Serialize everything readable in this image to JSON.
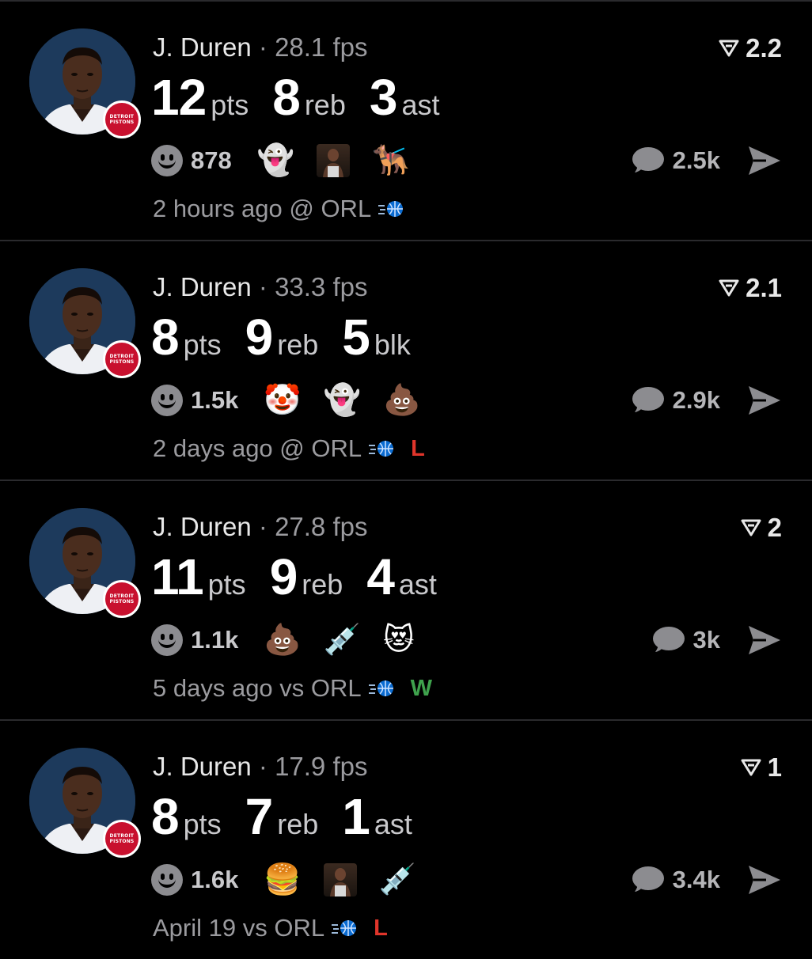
{
  "feed": {
    "cards": [
      {
        "player": "J. Duren",
        "separator": "·",
        "fps": "28.1 fps",
        "stats": [
          {
            "value": "12",
            "label": "pts"
          },
          {
            "value": "8",
            "label": "reb"
          },
          {
            "value": "3",
            "label": "ast"
          }
        ],
        "rating": "2.2",
        "reaction_count": "878",
        "reactions": [
          {
            "type": "emoji",
            "char": "👻",
            "name": "ghost-emoji"
          },
          {
            "type": "image",
            "name": "player-photo-reaction"
          },
          {
            "type": "emoji",
            "char": "🐕‍🦺",
            "name": "service-dog-emoji"
          }
        ],
        "comment_count": "2.5k",
        "time": "2 hours ago",
        "venue": "@ ORL",
        "result": ""
      },
      {
        "player": "J. Duren",
        "separator": "·",
        "fps": "33.3 fps",
        "stats": [
          {
            "value": "8",
            "label": "pts"
          },
          {
            "value": "9",
            "label": "reb"
          },
          {
            "value": "5",
            "label": "blk"
          }
        ],
        "rating": "2.1",
        "reaction_count": "1.5k",
        "reactions": [
          {
            "type": "emoji",
            "char": "🤡",
            "name": "clown-emoji"
          },
          {
            "type": "emoji",
            "char": "👻",
            "name": "ghost-emoji"
          },
          {
            "type": "emoji",
            "char": "💩",
            "name": "poop-emoji"
          }
        ],
        "comment_count": "2.9k",
        "time": "2 days ago",
        "venue": "@ ORL",
        "result": "L"
      },
      {
        "player": "J. Duren",
        "separator": "·",
        "fps": "27.8 fps",
        "stats": [
          {
            "value": "11",
            "label": "pts"
          },
          {
            "value": "9",
            "label": "reb"
          },
          {
            "value": "4",
            "label": "ast"
          }
        ],
        "rating": "2",
        "reaction_count": "1.1k",
        "reactions": [
          {
            "type": "emoji",
            "char": "💩",
            "name": "poop-emoji"
          },
          {
            "type": "emoji",
            "char": "💉",
            "name": "syringe-emoji"
          },
          {
            "type": "emoji",
            "char": "😻",
            "name": "heart-eyes-cat-emoji"
          }
        ],
        "comment_count": "3k",
        "time": "5 days ago",
        "venue": "vs ORL",
        "result": "W"
      },
      {
        "player": "J. Duren",
        "separator": "·",
        "fps": "17.9 fps",
        "stats": [
          {
            "value": "8",
            "label": "pts"
          },
          {
            "value": "7",
            "label": "reb"
          },
          {
            "value": "1",
            "label": "ast"
          }
        ],
        "rating": "1",
        "reaction_count": "1.6k",
        "reactions": [
          {
            "type": "emoji",
            "char": "🍔",
            "name": "hamburger-emoji"
          },
          {
            "type": "image",
            "name": "player-photo-reaction"
          },
          {
            "type": "emoji",
            "char": "💉",
            "name": "syringe-emoji"
          }
        ],
        "comment_count": "3.4k",
        "time": "April 19",
        "venue": "vs ORL",
        "result": "L"
      }
    ],
    "team_badge_text": "DETROIT PISTONS",
    "colors": {
      "background": "#000000",
      "divider": "#2a2a2d",
      "loss": "#e0352b",
      "win": "#3fa24d",
      "team_primary": "#c8102e",
      "avatar_bg": "#1d3a5c"
    }
  }
}
